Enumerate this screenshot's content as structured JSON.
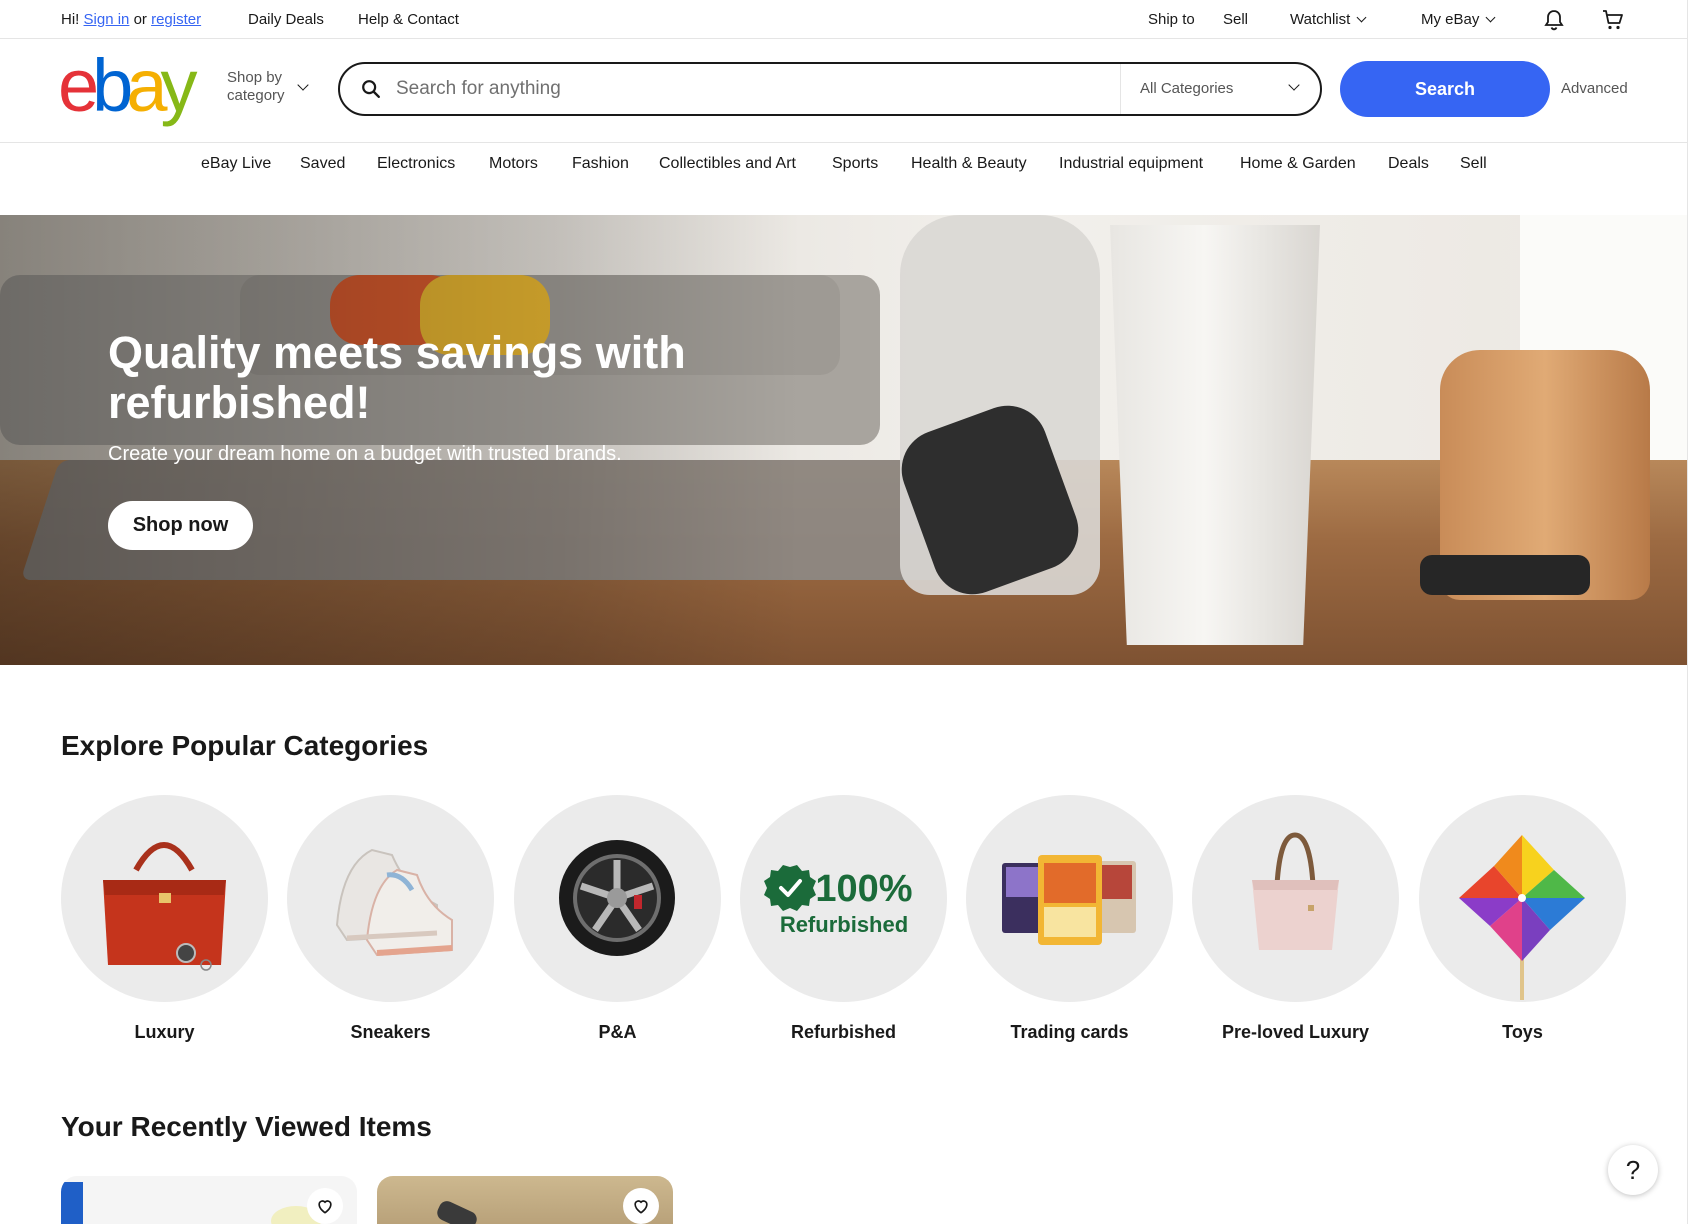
{
  "topbar": {
    "greeting": "Hi!",
    "sign_in": "Sign in",
    "or": "or",
    "register": "register",
    "daily_deals": "Daily Deals",
    "help_contact": "Help & Contact",
    "ship_to": "Ship to",
    "sell": "Sell",
    "watchlist": "Watchlist",
    "my_ebay": "My eBay",
    "notification_icon": "bell-icon",
    "cart_icon": "cart-icon"
  },
  "header": {
    "logo_letters": [
      "e",
      "b",
      "a",
      "y"
    ],
    "logo_colors": [
      "#e53238",
      "#0064d2",
      "#f5af02",
      "#86b817"
    ],
    "shop_by_category": "Shop by category",
    "search_placeholder": "Search for anything",
    "category_select": "All Categories",
    "search_button": "Search",
    "advanced": "Advanced",
    "accent_color": "#3665f3"
  },
  "nav": {
    "items": [
      "eBay Live",
      "Saved",
      "Electronics",
      "Motors",
      "Fashion",
      "Collectibles and Art",
      "Sports",
      "Health & Beauty",
      "Industrial equipment",
      "Home & Garden",
      "Deals",
      "Sell"
    ]
  },
  "hero": {
    "title": "Quality meets savings with refurbished!",
    "subtitle": "Create your dream home on a budget with trusted brands.",
    "button": "Shop now"
  },
  "popular": {
    "title": "Explore Popular Categories",
    "items": [
      {
        "label": "Luxury",
        "icon": "handbag-icon"
      },
      {
        "label": "Sneakers",
        "icon": "sneaker-icon"
      },
      {
        "label": "P&A",
        "icon": "wheel-icon"
      },
      {
        "label": "Refurbished",
        "icon": "refurbished-badge-icon",
        "badge_line1": "100%",
        "badge_line2": "Refurbished"
      },
      {
        "label": "Trading cards",
        "icon": "trading-cards-icon"
      },
      {
        "label": "Pre-loved Luxury",
        "icon": "tote-bag-icon"
      },
      {
        "label": "Toys",
        "icon": "pinwheel-icon"
      }
    ]
  },
  "recent": {
    "title": "Your Recently Viewed Items"
  },
  "help": {
    "label": "?"
  }
}
